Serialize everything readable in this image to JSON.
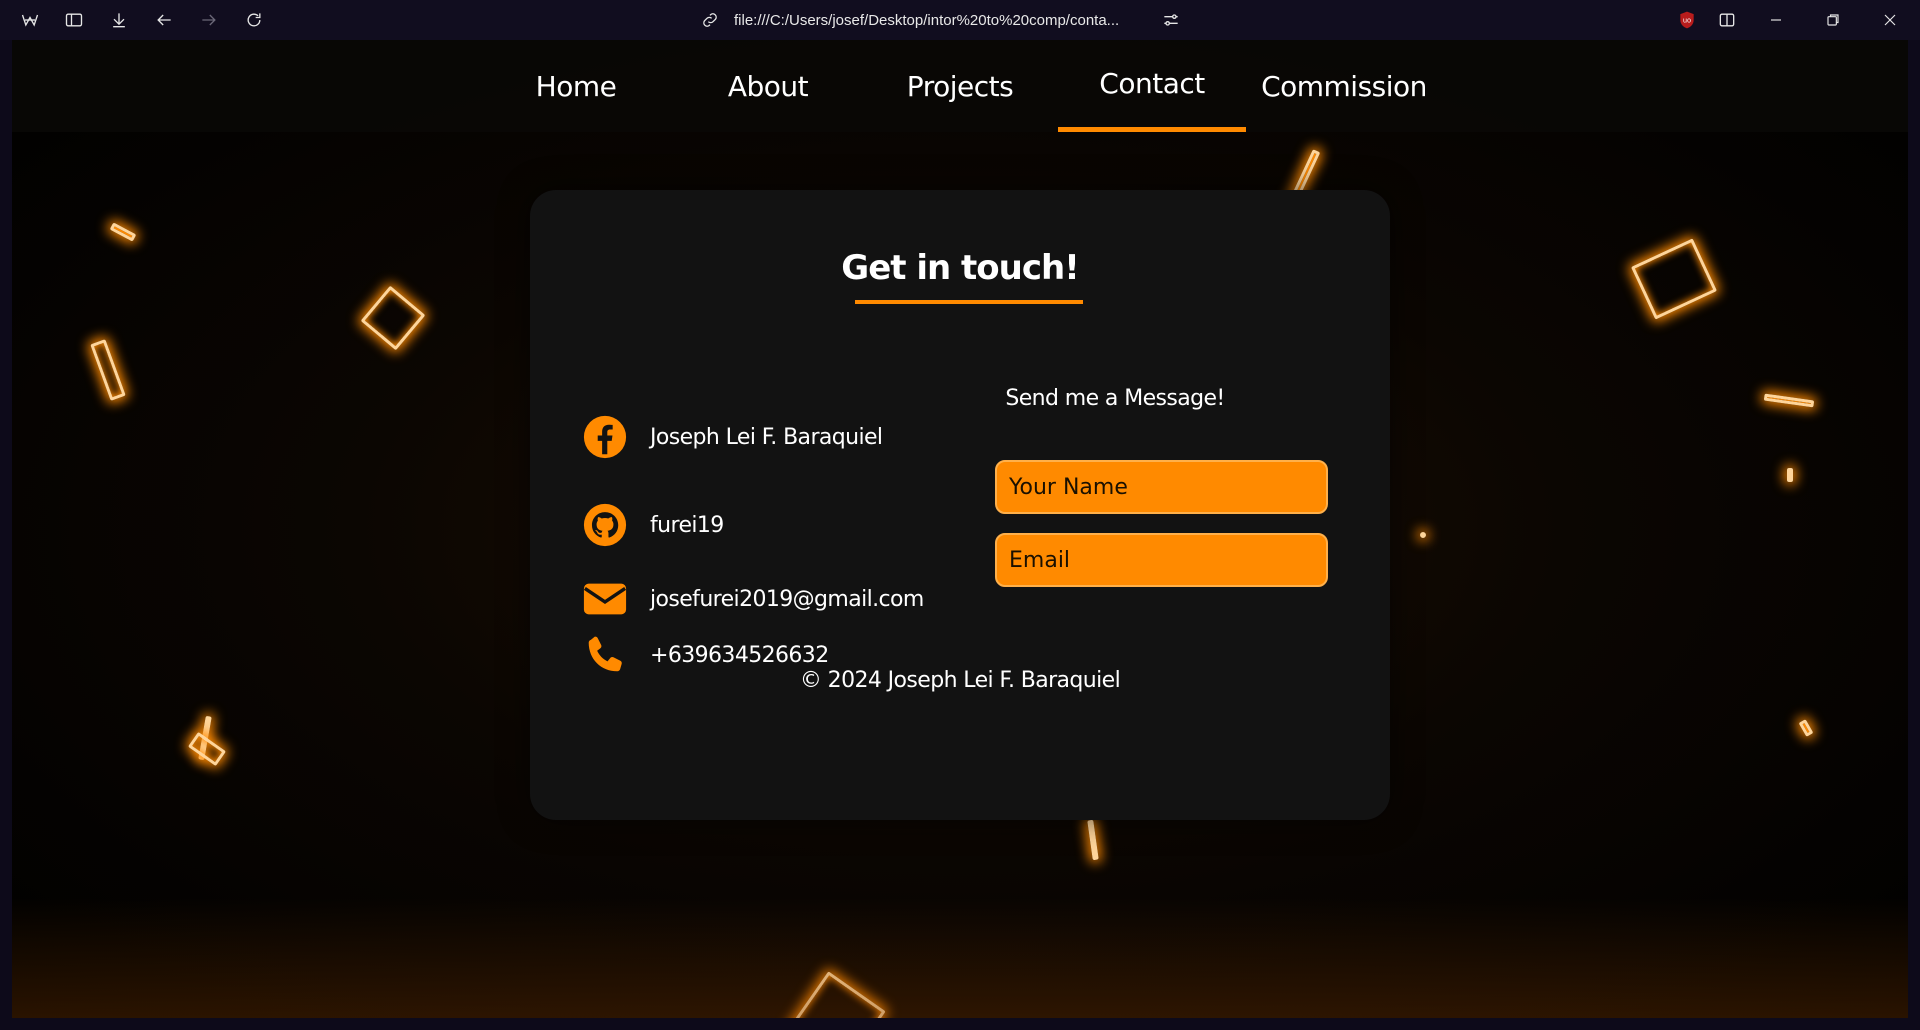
{
  "browser": {
    "url": "file:///C:/Users/josef/Desktop/intor%20to%20comp/conta...",
    "icons": [
      "workspaces-icon",
      "sidebar-icon",
      "download-icon",
      "back-icon",
      "forward-icon",
      "reload-icon",
      "link-icon",
      "site-settings-icon",
      "ublock-icon",
      "split-view-icon",
      "minimize-icon",
      "restore-icon",
      "close-icon"
    ]
  },
  "nav": {
    "items": [
      {
        "label": "Home"
      },
      {
        "label": "About"
      },
      {
        "label": "Projects"
      },
      {
        "label": "Contact"
      },
      {
        "label": "Commission"
      }
    ],
    "active": "Contact"
  },
  "card": {
    "title": "Get in touch!",
    "contacts": [
      {
        "icon": "facebook-icon",
        "text": "Joseph Lei F. Baraquiel"
      },
      {
        "icon": "github-icon",
        "text": "furei19"
      },
      {
        "icon": "envelope-icon",
        "text": "josefurei2019@gmail.com"
      },
      {
        "icon": "phone-icon",
        "text": "+639634526632"
      }
    ],
    "form": {
      "title": "Send me a Message!",
      "name_placeholder": "Your Name",
      "email_placeholder": "Email"
    },
    "footer": "© 2024 Joseph Lei F. Baraquiel"
  },
  "colors": {
    "accent": "#ff8a00",
    "card_bg": "#121212",
    "nav_bg": "#0a0806",
    "text": "#ffffff"
  }
}
